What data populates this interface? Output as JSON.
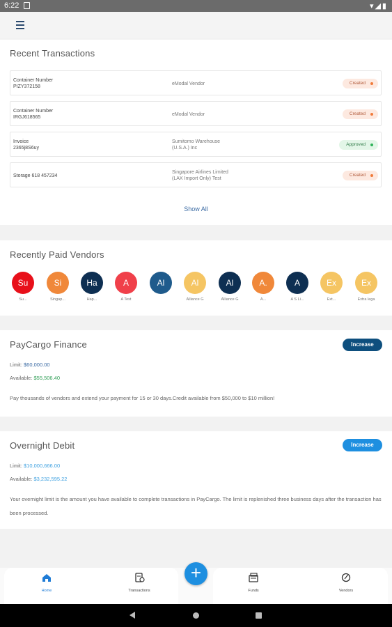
{
  "status_bar": {
    "time": "6:22",
    "right_glyphs": "▾◢▮"
  },
  "recent_transactions": {
    "title": "Recent Transactions",
    "rows": [
      {
        "left": [
          "Container Number",
          "PIZY372158"
        ],
        "mid": [
          "eModal Vendor"
        ],
        "status": "Created"
      },
      {
        "left": [
          "Container Number",
          "IRGJ618565"
        ],
        "mid": [
          "eModal Vendor"
        ],
        "status": "Created"
      },
      {
        "left": [
          "Invoice",
          "2365j8S6uy"
        ],
        "mid": [
          "Sumitomo Warehouse",
          "(U.S.A.) Inc"
        ],
        "status": "Approved"
      },
      {
        "left": [
          "Storage 618 457234"
        ],
        "mid": [
          "Singapore Airlines Limited",
          "(LAX Import Only) Test"
        ],
        "status": "Created"
      }
    ],
    "show_all": "Show All"
  },
  "recently_paid_vendors": {
    "title": "Recently Paid Vendors",
    "vendors": [
      {
        "initials": "Su",
        "label": "Su...",
        "color": "#e8101a"
      },
      {
        "initials": "Si",
        "label": "Singap...",
        "color": "#f0883a"
      },
      {
        "initials": "Ha",
        "label": "Hap...",
        "color": "#0e2f52"
      },
      {
        "initials": "A",
        "label": "A Test",
        "color": "#f0404a"
      },
      {
        "initials": "Al",
        "label": "",
        "color": "#1f5b8c"
      },
      {
        "initials": "Al",
        "label": "Alliance G",
        "color": "#f5c563"
      },
      {
        "initials": "Al",
        "label": "Alliance G",
        "color": "#0e2f52"
      },
      {
        "initials": "A.",
        "label": "A...",
        "color": "#f0883a"
      },
      {
        "initials": "A",
        "label": "A S Li...",
        "color": "#0e2f52"
      },
      {
        "initials": "Ex",
        "label": "Ext...",
        "color": "#f5c563"
      },
      {
        "initials": "Ex",
        "label": "Extra lega",
        "color": "#f5c563"
      }
    ]
  },
  "paycargo_finance": {
    "title": "PayCargo Finance",
    "limit_label": "Limit:",
    "limit_value": "$60,000.00",
    "available_label": "Available:",
    "available_value": "$55,506.40",
    "description": "Pay thousands of vendors and extend your payment for 15 or 30 days.Credit available from $50,000 to $10 million!",
    "button": "Increase",
    "button_color": "#0e4f7e"
  },
  "overnight_debit": {
    "title": "Overnight Debit",
    "limit_label": "Limit:",
    "limit_value": "$10,000,666.00",
    "available_label": "Available:",
    "available_value": "$3,232,595.22",
    "description": "Your overnight limit is the amount you have available to complete transactions in PayCargo. The limit is replenished three business days after the transaction has been processed.",
    "button": "Increase",
    "button_color": "#1e8fe0"
  },
  "bottom_nav": {
    "items": [
      {
        "label": "Home",
        "icon": "home-icon",
        "active": true
      },
      {
        "label": "Transactions",
        "icon": "transactions-icon",
        "active": false
      },
      {
        "label": "Funds",
        "icon": "funds-icon",
        "active": false
      },
      {
        "label": "Vendors",
        "icon": "vendors-icon",
        "active": false
      }
    ],
    "fab": "+"
  },
  "colors": {
    "accent": "#1e8fe0",
    "brand_dark": "#0e4f7e",
    "created": "#f07a3a",
    "approved": "#2fb35a"
  }
}
